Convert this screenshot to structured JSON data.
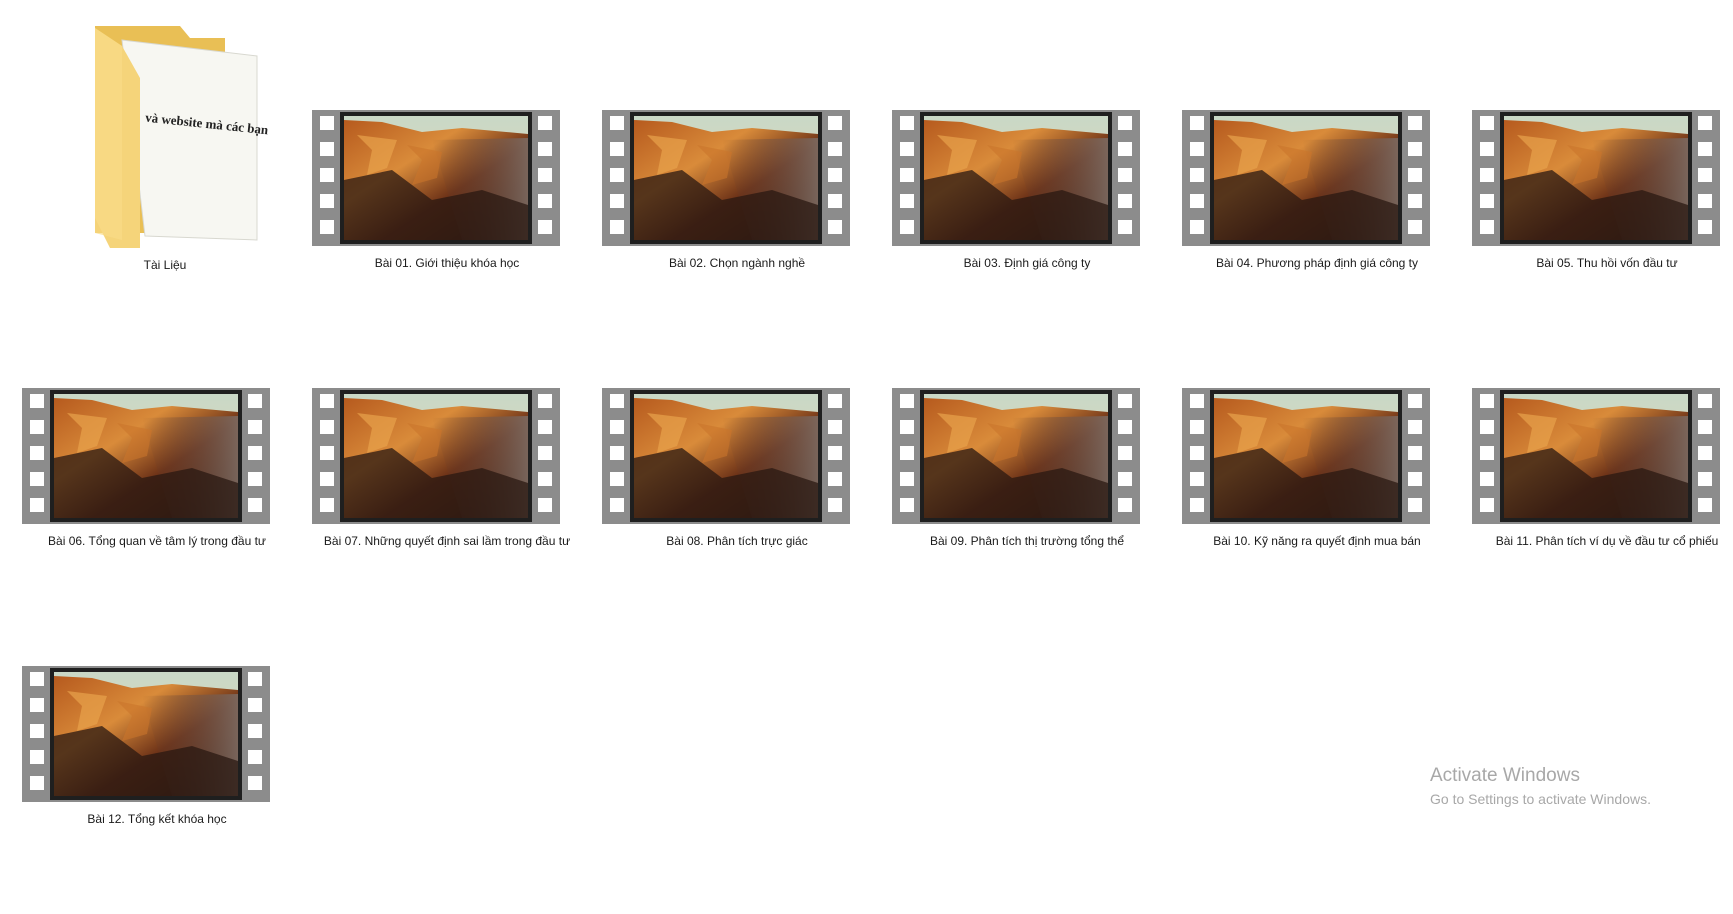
{
  "folder": {
    "name": "Tài Liệu",
    "preview_text": "và website mà các bạn",
    "icon": "folder-icon"
  },
  "videos": [
    {
      "name": "Bài 01. Giới thiệu khóa học"
    },
    {
      "name": "Bài 02. Chọn ngành nghề"
    },
    {
      "name": "Bài 03. Định giá công ty"
    },
    {
      "name": "Bài 04. Phương pháp định giá công ty"
    },
    {
      "name": "Bài 05. Thu hồi vốn đầu tư"
    },
    {
      "name": "Bài 06. Tổng quan về tâm lý trong đầu tư"
    },
    {
      "name": "Bài 07. Những quyết định sai lầm trong đầu tư"
    },
    {
      "name": "Bài 08. Phân tích trực giác"
    },
    {
      "name": "Bài 09. Phân tích thị trường tổng thể"
    },
    {
      "name": "Bài 10. Kỹ năng ra quyết định mua bán"
    },
    {
      "name": "Bài 11. Phân tích ví dụ về đầu tư cổ phiếu"
    },
    {
      "name": "Bài 12. Tổng kết khóa học"
    }
  ],
  "watermark": {
    "title": "Activate Windows",
    "subtitle": "Go to Settings to activate Windows."
  },
  "colors": {
    "film_frame": "#8c8c8c",
    "film_hole": "#ffffff",
    "folder": "#f2cf6a"
  }
}
